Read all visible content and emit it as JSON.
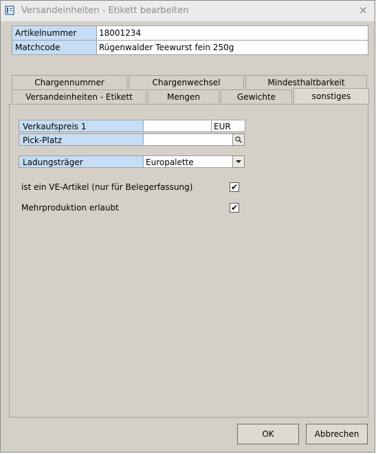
{
  "window": {
    "title": "Versandeinheiten - Etikett bearbeiten",
    "close_glyph": "×"
  },
  "info": [
    {
      "label": "Artikelnummer",
      "value": "18001234"
    },
    {
      "label": "Matchcode",
      "value": "Rügenwalder Teewurst fein 250g"
    }
  ],
  "tabs_back": [
    "Chargennummer",
    "Chargenwechsel",
    "Mindesthaltbarkeit"
  ],
  "tabs_front": [
    "Versandeinheiten - Etikett",
    "Mengen",
    "Gewichte",
    "sonstiges"
  ],
  "active_tab": "sonstiges",
  "fields": {
    "verkaufspreis_label": "Verkaufspreis 1",
    "verkaufspreis_value": "",
    "currency": "EUR",
    "pickplatz_label": "Pick-Platz",
    "pickplatz_value": "",
    "ladungstraeger_label": "Ladungsträger",
    "ladungstraeger_value": "Europalette"
  },
  "checks": [
    {
      "label": "ist ein VE-Artikel (nur für Belegerfassung)",
      "checked": true,
      "glyph": "✔"
    },
    {
      "label": "Mehrproduktion erlaubt",
      "checked": true,
      "glyph": "✔"
    }
  ],
  "buttons": {
    "ok": "OK",
    "cancel": "Abbrechen"
  },
  "icons": {
    "app": "form-edit-icon",
    "search": "magnifier-icon",
    "dropdown": "triangle-down-icon"
  }
}
